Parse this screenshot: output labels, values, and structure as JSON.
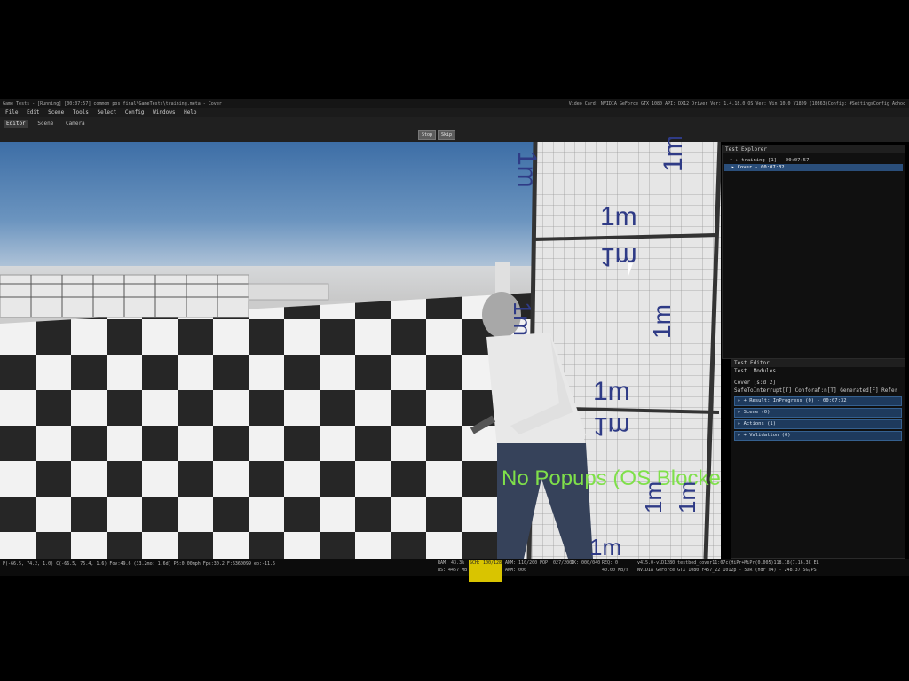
{
  "window": {
    "title": "Game Tests - [Running] [00:07:57] common_pos_final\\GameTests\\training.meta - Cover",
    "sysinfo": "Video Card: NVIDIA GeForce GTX 1080 API: DX12 Driver Ver: 1.4.18.0 OS Ver: Win 10.0 V1809 (10363)Config: #SettingsConfig_Adhoc"
  },
  "menu": [
    "File",
    "Edit",
    "Scene",
    "Tools",
    "Select",
    "Config",
    "Windows",
    "Help"
  ],
  "toolbar": {
    "tabs": [
      "Editor",
      "Scene",
      "Camera"
    ],
    "stop": "Stop",
    "skip": "Skip"
  },
  "viewport": {
    "wall_labels": [
      "1m",
      "1m",
      "1m",
      "1m",
      "1m",
      "1m",
      "1m",
      "1m",
      "1m",
      "1m",
      "1m"
    ],
    "overlay": "No Popups (OS Blocked)"
  },
  "test_explorer": {
    "title": "Test Explorer",
    "rows": [
      "▾ ▸ training [1] - 00:07:57",
      "▸ Cover - 00:07:32"
    ]
  },
  "test_editor": {
    "title": "Test Editor",
    "tabs": [
      "Test",
      "Modules"
    ],
    "name": "Cover [s:d 2]",
    "flags": "SafeToInterrupt[T] Conforaf:n[T] Generated[F] Refer",
    "sections": [
      "▸ + Result: InProgress (0) - 00:07:32",
      "▸ Scene (0)",
      "▸ Actions (1)",
      "▸ + Validation (0)"
    ]
  },
  "status": {
    "pos": "P(-66.5, 74.2, 1.0) C(-66.5, 75.4, 1.6) Fov:49.6 (33.2mo: 1.6d) PS:0.00mph Fps:30.2 F:6360099 eo:-11.5",
    "ram": "RAM: 43.3%",
    "ws": "WS: 4457 MB",
    "sch": "SCH: 100/128",
    "anm1": "ANM: 110/200",
    "anm2": "ANM: 000",
    "pop": "POP: 027/200",
    "ik": "IK: 000/040",
    "req": "REQ: 0",
    "mbps": "40.00 MB/s",
    "build1": "v415.0-v1D1280 testbed_cover11:07c(HiPr+MiPr(0.005)118.18(7.16.3C EL",
    "build2": "NVIDIA GeForce GTX 1080 r457_22 1012p - 5DR (hdr x4) - 248.37 SG/PS"
  }
}
